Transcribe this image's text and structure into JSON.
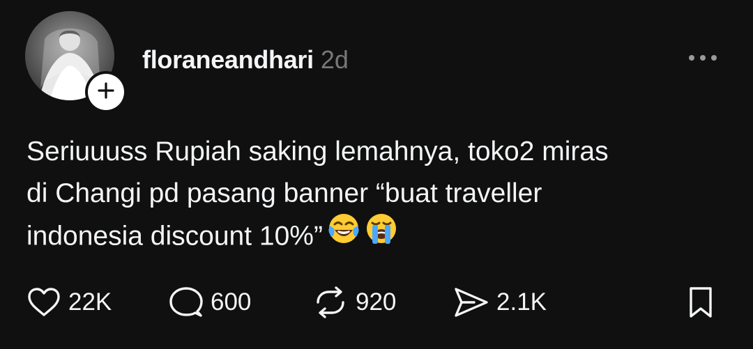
{
  "post": {
    "author": {
      "username": "floraneandhari",
      "timestamp": "2d",
      "avatar_icon": "profile-photo",
      "follow_icon": "plus-icon"
    },
    "text_lines": [
      "Seriuuuss Rupiah saking lemahnya, toko2 miras",
      "di Changi pd pasang banner “buat traveller",
      "indonesia discount 10%”"
    ],
    "emojis": [
      "face-with-tears-of-joy",
      "loudly-crying-face"
    ],
    "actions": {
      "like": {
        "icon": "heart-icon",
        "count": "22K"
      },
      "comment": {
        "icon": "comment-icon",
        "count": "600"
      },
      "repost": {
        "icon": "repost-icon",
        "count": "920"
      },
      "share": {
        "icon": "send-icon",
        "count": "2.1K"
      },
      "save": {
        "icon": "bookmark-icon"
      }
    },
    "more_icon": "more-options-icon"
  },
  "colors": {
    "background": "#101010",
    "text": "#f3f5f7",
    "muted": "#777777"
  }
}
